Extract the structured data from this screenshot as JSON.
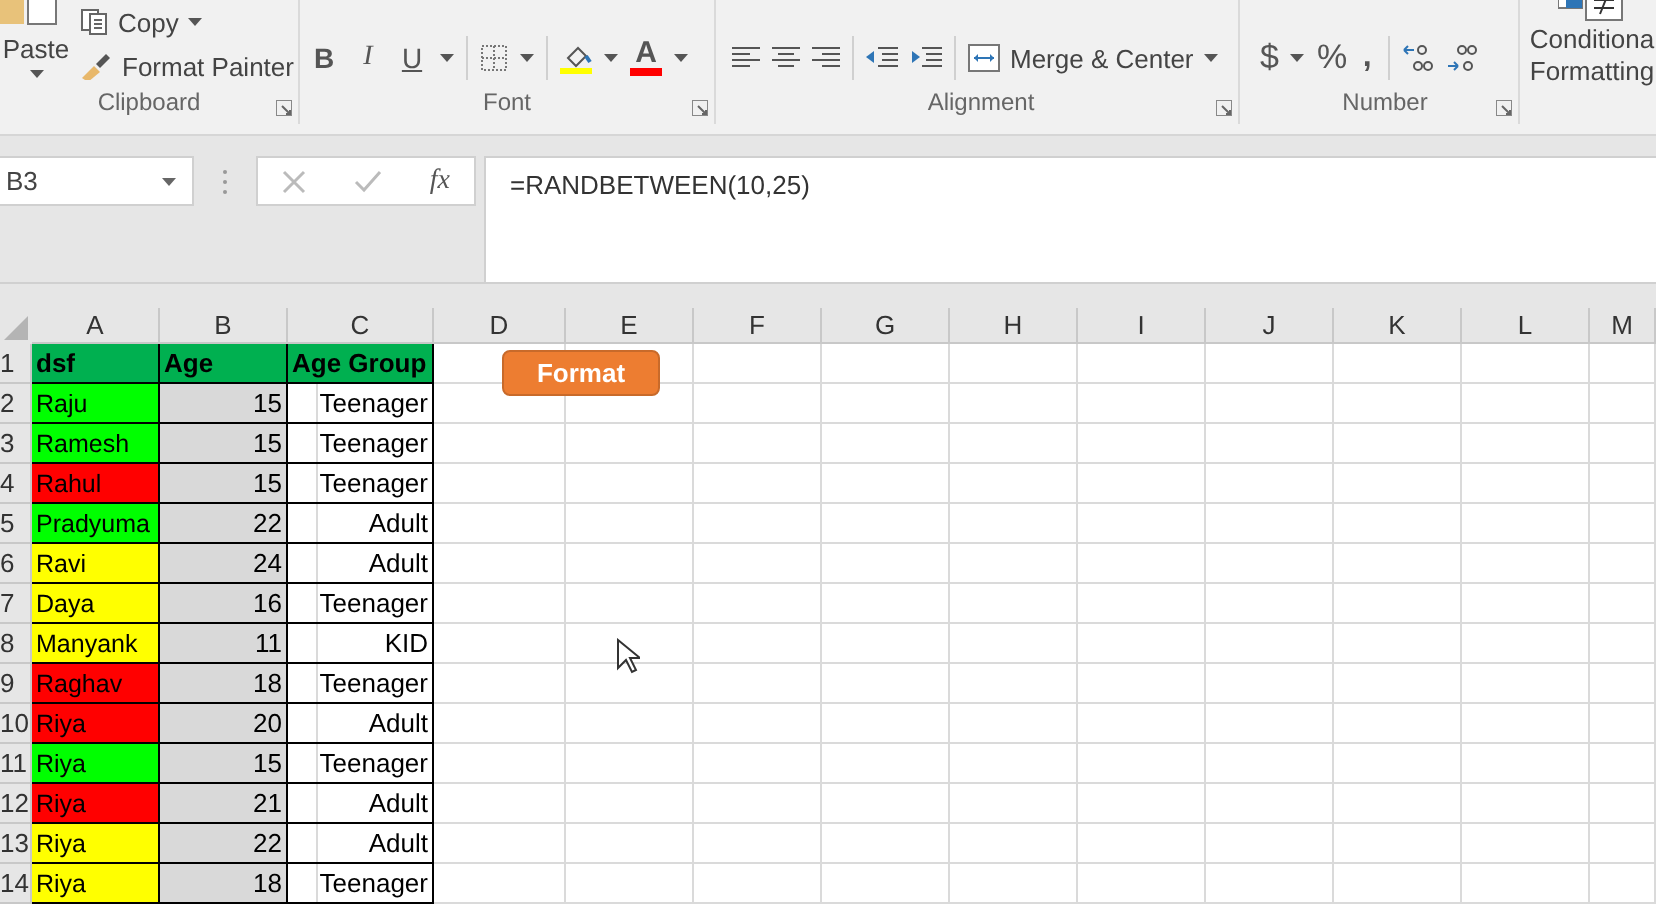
{
  "ribbon": {
    "clipboard": {
      "paste": "Paste",
      "copy": "Copy",
      "format_painter": "Format Painter",
      "label": "Clipboard"
    },
    "font": {
      "buttons": [
        "B",
        "I",
        "U"
      ],
      "font_color": "A",
      "label": "Font"
    },
    "alignment": {
      "merge": "Merge & Center",
      "label": "Alignment"
    },
    "number": {
      "currency": "$",
      "percent": "%",
      "comma": ",",
      "label": "Number"
    },
    "styles": {
      "conditional_formatting": [
        "Conditiona",
        "Formatting"
      ]
    }
  },
  "formula_bar": {
    "name_box": "B3",
    "function_label": "fx",
    "formula": "=RANDBETWEEN(10,25)"
  },
  "sheet": {
    "columns": [
      "A",
      "B",
      "C",
      "D",
      "E",
      "F",
      "G",
      "H",
      "I",
      "J",
      "K",
      "L",
      "M"
    ],
    "header": {
      "number": "1",
      "cells": [
        "dsf",
        "Age",
        "Age Group"
      ]
    },
    "rows": [
      {
        "number": "2",
        "name": "Raju",
        "color": "#00ff00",
        "age": "15",
        "group": "Teenager"
      },
      {
        "number": "3",
        "name": "Ramesh",
        "color": "#00ff00",
        "age": "15",
        "group": "Teenager"
      },
      {
        "number": "4",
        "name": "Rahul",
        "color": "#ff0000",
        "age": "15",
        "group": "Teenager"
      },
      {
        "number": "5",
        "name": "Pradyuma",
        "color": "#00ff00",
        "age": "22",
        "group": "Adult"
      },
      {
        "number": "6",
        "name": "Ravi",
        "color": "#ffff00",
        "age": "24",
        "group": "Adult"
      },
      {
        "number": "7",
        "name": "Daya",
        "color": "#ffff00",
        "age": "16",
        "group": "Teenager"
      },
      {
        "number": "8",
        "name": "Manyank",
        "color": "#ffff00",
        "age": "11",
        "group": "KID"
      },
      {
        "number": "9",
        "name": "Raghav",
        "color": "#ff0000",
        "age": "18",
        "group": "Teenager"
      },
      {
        "number": "10",
        "name": "Riya",
        "color": "#ff0000",
        "age": "20",
        "group": "Adult"
      },
      {
        "number": "11",
        "name": "Riya",
        "color": "#00ff00",
        "age": "15",
        "group": "Teenager"
      },
      {
        "number": "12",
        "name": "Riya",
        "color": "#ff0000",
        "age": "21",
        "group": "Adult"
      },
      {
        "number": "13",
        "name": "Riya",
        "color": "#ffff00",
        "age": "22",
        "group": "Adult"
      },
      {
        "number": "14",
        "name": "Riya",
        "color": "#ffff00",
        "age": "18",
        "group": "Teenager"
      }
    ],
    "shape_button": "Format"
  }
}
